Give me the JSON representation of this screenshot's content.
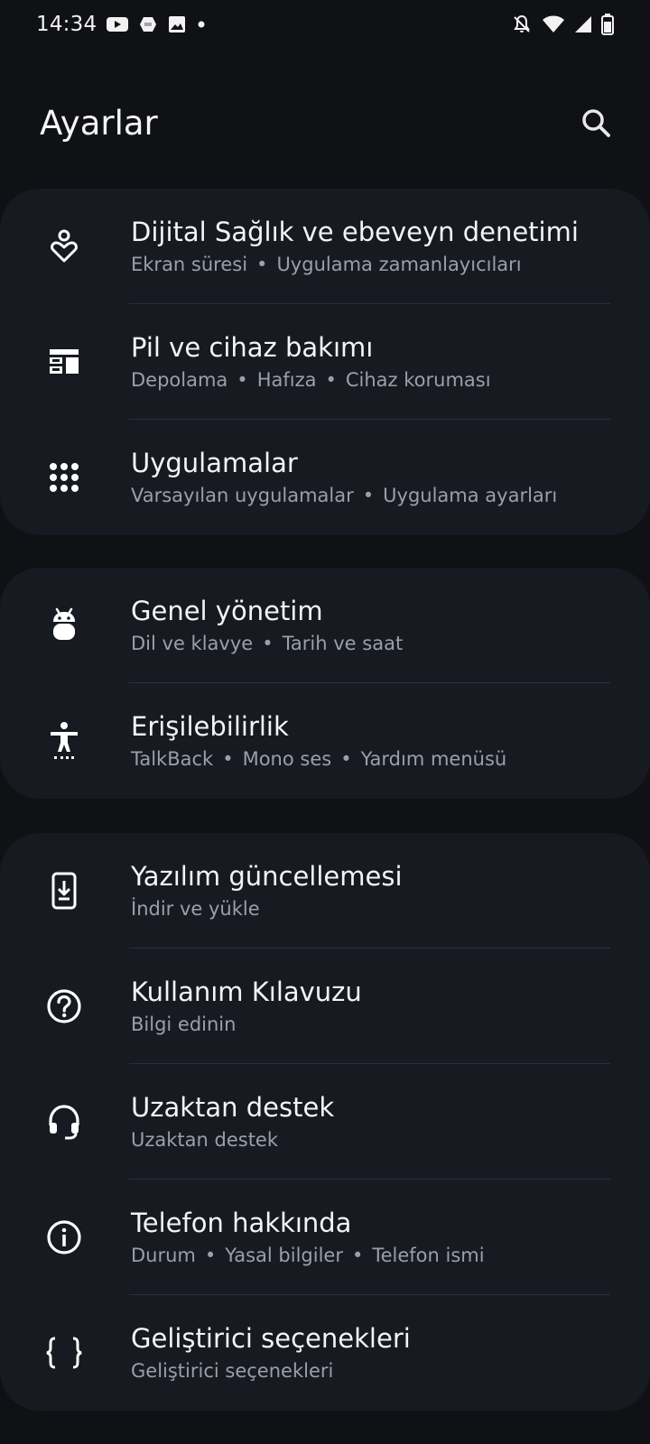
{
  "status_bar": {
    "time": "14:34",
    "left_icons": [
      "youtube-icon",
      "app-icon",
      "image-icon",
      "dot-icon"
    ],
    "right_icons": [
      "notifications-off-icon",
      "wifi-icon",
      "signal-icon",
      "battery-icon"
    ]
  },
  "header": {
    "title": "Ayarlar",
    "search_icon": "search-icon"
  },
  "groups": [
    {
      "items": [
        {
          "icon": "digital-wellbeing-icon",
          "title": "Dijital Sağlık ve ebeveyn denetimi",
          "subs": [
            "Ekran süresi",
            "Uygulama zamanlayıcıları"
          ]
        },
        {
          "icon": "battery-care-icon",
          "title": "Pil ve cihaz bakımı",
          "subs": [
            "Depolama",
            "Hafıza",
            "Cihaz koruması"
          ]
        },
        {
          "icon": "apps-grid-icon",
          "title": "Uygulamalar",
          "subs": [
            "Varsayılan uygulamalar",
            "Uygulama ayarları"
          ]
        }
      ]
    },
    {
      "items": [
        {
          "icon": "general-management-icon",
          "title": "Genel yönetim",
          "subs": [
            "Dil ve klavye",
            "Tarih ve saat"
          ]
        },
        {
          "icon": "accessibility-icon",
          "title": "Erişilebilirlik",
          "subs": [
            "TalkBack",
            "Mono ses",
            "Yardım menüsü"
          ]
        }
      ]
    },
    {
      "items": [
        {
          "icon": "software-update-icon",
          "title": "Yazılım güncellemesi",
          "subs": [
            "İndir ve yükle"
          ]
        },
        {
          "icon": "help-icon",
          "title": "Kullanım Kılavuzu",
          "subs": [
            "Bilgi edinin"
          ]
        },
        {
          "icon": "headset-icon",
          "title": "Uzaktan destek",
          "subs": [
            "Uzaktan destek"
          ]
        },
        {
          "icon": "info-icon",
          "title": "Telefon hakkında",
          "subs": [
            "Durum",
            "Yasal bilgiler",
            "Telefon ismi"
          ]
        },
        {
          "icon": "developer-braces-icon",
          "title": "Geliştirici seçenekleri",
          "subs": [
            "Geliştirici seçenekleri"
          ]
        }
      ]
    }
  ]
}
